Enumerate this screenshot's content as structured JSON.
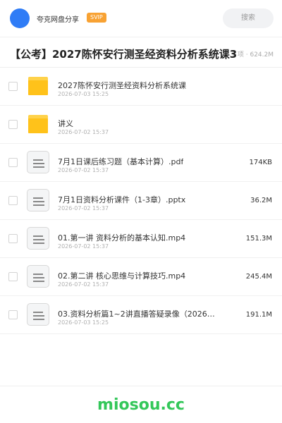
{
  "header": {
    "username": "夸克网盘分享",
    "vip_badge": "SVIP",
    "search_placeholder": "搜索"
  },
  "folder": {
    "title": "【公考】2027陈怀安行测圣经资料分析系统课3",
    "meta": "7 项 · 624.2M"
  },
  "files": [
    {
      "type": "folder",
      "name": "2027陈怀安行测圣经资料分析系统课",
      "date": "2026-07-03 15:25",
      "size": ""
    },
    {
      "type": "folder",
      "name": "讲义",
      "date": "2026-07-02 15:37",
      "size": ""
    },
    {
      "type": "doc",
      "name": "7月1日课后练习题（基本计算）.pdf",
      "date": "2026-07-02 15:37",
      "size": "174KB"
    },
    {
      "type": "doc",
      "name": "7月1日资料分析课件（1-3章）.pptx",
      "date": "2026-07-02 15:37",
      "size": "36.2M"
    },
    {
      "type": "doc",
      "name": "01.第一讲 资料分析的基本认知.mp4",
      "date": "2026-07-02 15:37",
      "size": "151.3M"
    },
    {
      "type": "doc",
      "name": "02.第二讲 核心思维与计算技巧.mp4",
      "date": "2026-07-02 15:37",
      "size": "245.4M"
    },
    {
      "type": "doc",
      "name": "03.资料分析篇1~2讲直播答疑录像（2026年7…",
      "date": "2026-07-03 15:25",
      "size": "191.1M"
    }
  ],
  "footer": {
    "watermark": "miosou.cc"
  },
  "colors": {
    "avatar": "#2f7cf6",
    "vip": "#f8a233",
    "folder": "#ffc21a",
    "watermark": "#34c75a"
  }
}
